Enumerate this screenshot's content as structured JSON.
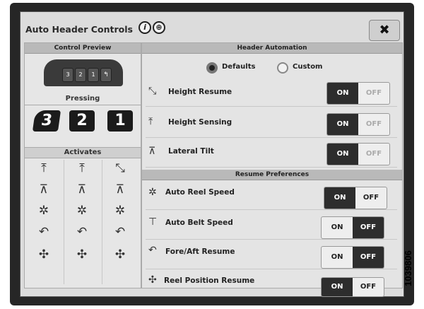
{
  "window": {
    "title": "Auto Header Controls",
    "close_label": "✖"
  },
  "left_panel": {
    "preview_header": "Control Preview",
    "preview_buttons": [
      "3",
      "2",
      "1"
    ],
    "pressing_label": "Pressing",
    "pressing_buttons": [
      "3",
      "2",
      "1"
    ],
    "activates_label": "Activates"
  },
  "header_automation": {
    "header": "Header Automation",
    "options": [
      {
        "label": "Defaults",
        "selected": true
      },
      {
        "label": "Custom",
        "selected": false
      }
    ],
    "rows": [
      {
        "label": "Height Resume",
        "icon": "height-resume-icon",
        "state": "ON"
      },
      {
        "label": "Height Sensing",
        "icon": "height-sensing-icon",
        "state": "ON"
      },
      {
        "label": "Lateral Tilt",
        "icon": "lateral-tilt-icon",
        "state": "ON"
      }
    ]
  },
  "resume_preferences": {
    "header": "Resume Preferences",
    "rows": [
      {
        "label": "Auto Reel Speed",
        "icon": "auto-reel-speed-icon",
        "state": "ON"
      },
      {
        "label": "Auto Belt Speed",
        "icon": "auto-belt-speed-icon",
        "state": "OFF"
      },
      {
        "label": "Fore/Aft Resume",
        "icon": "fore-aft-resume-icon",
        "state": "OFF"
      },
      {
        "label": "Reel Position Resume",
        "icon": "reel-position-resume-icon",
        "state": "ON"
      }
    ]
  },
  "toggle": {
    "on": "ON",
    "off": "OFF"
  },
  "image_code": "1039806"
}
